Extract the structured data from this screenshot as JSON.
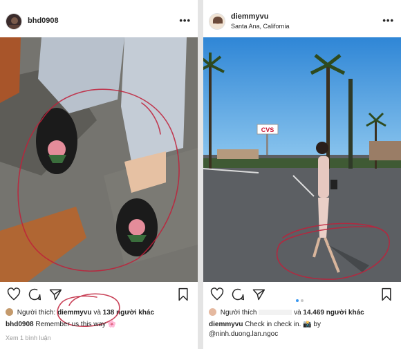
{
  "left_post": {
    "username": "bhd0908",
    "more_label": "•••",
    "likes_prefix": "Người thích:",
    "likes_user": "diemmyvu",
    "likes_and": "và",
    "likes_count": "138 người khác",
    "caption_user": "bhd0908",
    "caption_text": "Remember us this way",
    "caption_emoji": "🌸",
    "view_comments": "Xem 1 bình luận"
  },
  "right_post": {
    "username": "diemmyvu",
    "location": "Santa Ana, California",
    "more_label": "•••",
    "likes_prefix": "Người thích",
    "likes_and": "và",
    "likes_count": "14.469 người khác",
    "caption_user": "diemmyvu",
    "caption_text": "Check in check in.",
    "caption_emoji": "📸",
    "caption_by": "by",
    "caption_mention": "@ninh.duong.lan.ngoc",
    "sign_text": "CVS"
  },
  "colors": {
    "ink_red": "#c0203a",
    "carousel_active": "#3897f0",
    "carousel_inactive": "#c7c7c7",
    "text": "#262626",
    "muted": "#999999"
  },
  "icons": [
    "heart-icon",
    "comment-icon",
    "share-icon",
    "bookmark-icon",
    "more-icon"
  ]
}
